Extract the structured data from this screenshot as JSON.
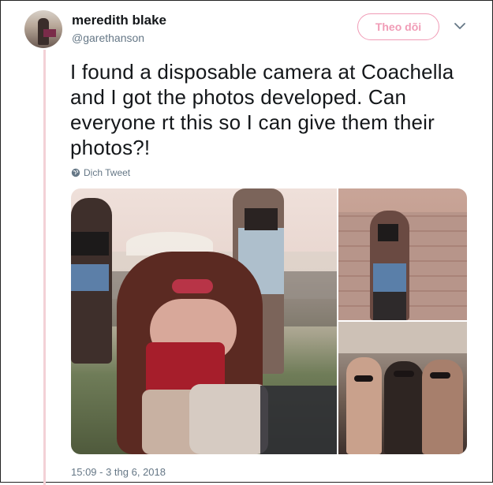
{
  "author": {
    "name": "meredith blake",
    "handle": "@garethanson"
  },
  "follow_button": {
    "label": "Theo dõi"
  },
  "menu": {
    "icon": "chevron-down-icon"
  },
  "tweet": {
    "text": "I found a disposable camera at Coachella and I got the photos developed. Can everyone rt this so I can give them their photos?!",
    "translate_label": "Dịch Tweet",
    "timestamp": "15:09 - 3 thg 6, 2018"
  },
  "colors": {
    "accent": "#e0245e",
    "muted": "#657786",
    "text": "#14171a",
    "thread_line": "#f3d1d6"
  }
}
